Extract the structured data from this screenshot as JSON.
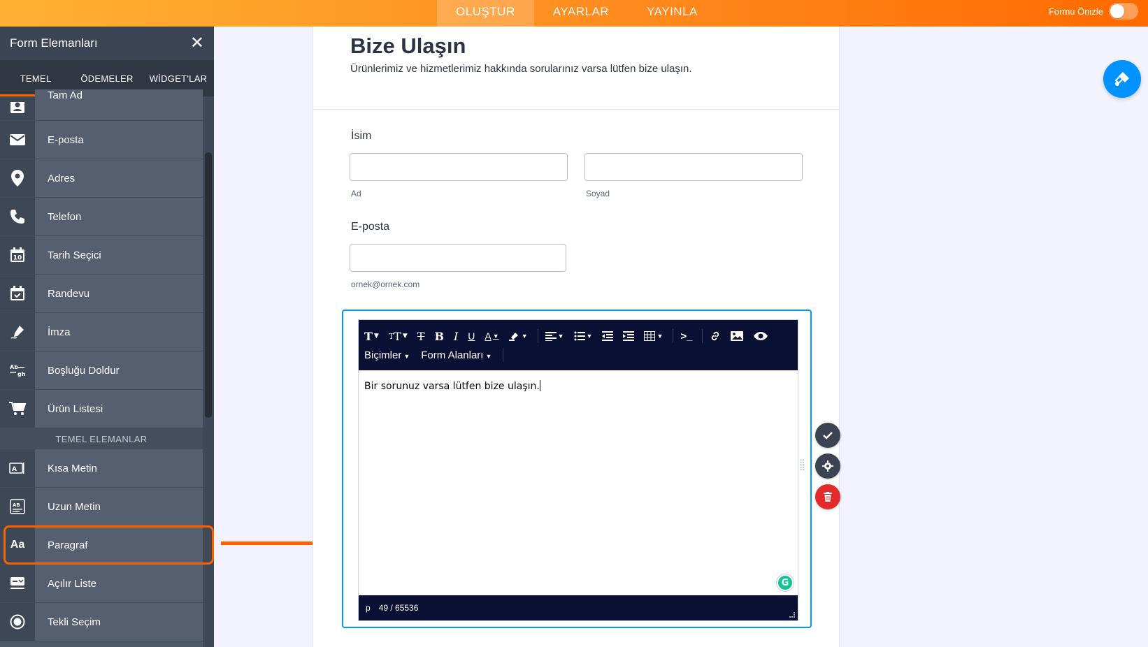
{
  "topnav": {
    "tabs": [
      {
        "label": "OLUŞTUR",
        "active": true
      },
      {
        "label": "AYARLAR",
        "active": false
      },
      {
        "label": "YAYINLA",
        "active": false
      }
    ],
    "preview_label": "Formu Önizle"
  },
  "sidebar": {
    "title": "Form Elemanları",
    "tabs": [
      "TEMEL",
      "ÖDEMELER",
      "WİDGET'LAR"
    ],
    "items": [
      {
        "label": "Tam Ad",
        "icon": "user-card-icon"
      },
      {
        "label": "E-posta",
        "icon": "envelope-icon"
      },
      {
        "label": "Adres",
        "icon": "map-pin-icon"
      },
      {
        "label": "Telefon",
        "icon": "phone-icon"
      },
      {
        "label": "Tarih Seçici",
        "icon": "calendar-icon"
      },
      {
        "label": "Randevu",
        "icon": "calendar-check-icon"
      },
      {
        "label": "İmza",
        "icon": "pen-icon"
      },
      {
        "label": "Boşluğu Doldur",
        "icon": "fill-blank-icon"
      },
      {
        "label": "Ürün Listesi",
        "icon": "cart-icon"
      }
    ],
    "section_label": "TEMEL ELEMANLAR",
    "basic_items": [
      {
        "label": "Kısa Metin",
        "icon": "short-text-icon"
      },
      {
        "label": "Uzun Metin",
        "icon": "long-text-icon"
      },
      {
        "label": "Paragraf",
        "icon": "paragraph-icon",
        "icon_text": "Aa"
      },
      {
        "label": "Açılır Liste",
        "icon": "dropdown-icon"
      },
      {
        "label": "Tekli Seçim",
        "icon": "radio-icon"
      }
    ]
  },
  "form": {
    "title": "Bize Ulaşın",
    "subtitle": "Ürünlerimiz ve hizmetlerimiz hakkında sorularınız varsa lütfen bize ulaşın.",
    "name_label": "İsim",
    "first_sublabel": "Ad",
    "last_sublabel": "Soyad",
    "email_label": "E-posta",
    "email_sublabel": "ornek@ornek.com",
    "editor": {
      "menu_formats": "Biçimler",
      "menu_fields": "Form Alanları",
      "content": "Bir sorunuz varsa lütfen bize ulaşın.",
      "status_tag": "p",
      "status_count": "49 / 65536",
      "grammarly_letter": "G"
    }
  },
  "colors": {
    "accent_orange": "#ff6100",
    "editor_dark": "#0a1033",
    "selection_blue": "#0099ff",
    "delete_red": "#e22b2b"
  }
}
